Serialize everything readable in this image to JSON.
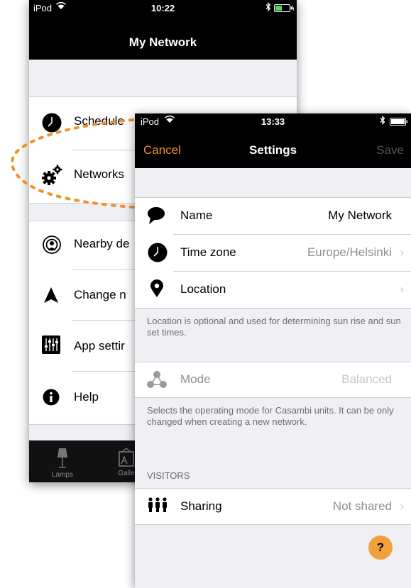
{
  "back_screen": {
    "status": {
      "device": "iPod",
      "time": "10:22"
    },
    "title": "My Network",
    "items": [
      {
        "label": "Schedule",
        "icon": "clock-icon"
      },
      {
        "label": "Networks",
        "icon": "gears-icon"
      },
      {
        "label": "Nearby de",
        "icon": "nearby-icon"
      },
      {
        "label": "Change n",
        "icon": "navigation-arrow-icon"
      },
      {
        "label": "App settir",
        "icon": "sliders-icon"
      },
      {
        "label": "Help",
        "icon": "info-icon"
      }
    ],
    "tabs": [
      {
        "label": "Lamps",
        "icon": "lamp-icon"
      },
      {
        "label": "Galle",
        "icon": "gallery-icon"
      }
    ]
  },
  "front_screen": {
    "status": {
      "device": "iPod",
      "time": "13:33"
    },
    "cancel_label": "Cancel",
    "title": "Settings",
    "save_label": "Save",
    "rows": {
      "name": {
        "label": "Name",
        "value": "My Network",
        "icon": "speech-bubble-icon"
      },
      "timezone": {
        "label": "Time zone",
        "value": "Europe/Helsinki",
        "icon": "clock-icon"
      },
      "location": {
        "label": "Location",
        "value": "",
        "icon": "location-pin-icon"
      }
    },
    "location_note": "Location is optional and used for determining sun rise and sun set times.",
    "mode": {
      "label": "Mode",
      "value": "Balanced",
      "icon": "network-nodes-icon"
    },
    "mode_note": "Selects the operating mode for Casambi units. It can be only changed when creating a new network.",
    "visitors_header": "VISITORS",
    "sharing": {
      "label": "Sharing",
      "value": "Not shared",
      "icon": "people-icon"
    },
    "help_label": "?"
  },
  "colors": {
    "accent": "#f0912d",
    "help_button": "#f2a03c",
    "navbar": "#000000",
    "background": "#efeff4"
  }
}
